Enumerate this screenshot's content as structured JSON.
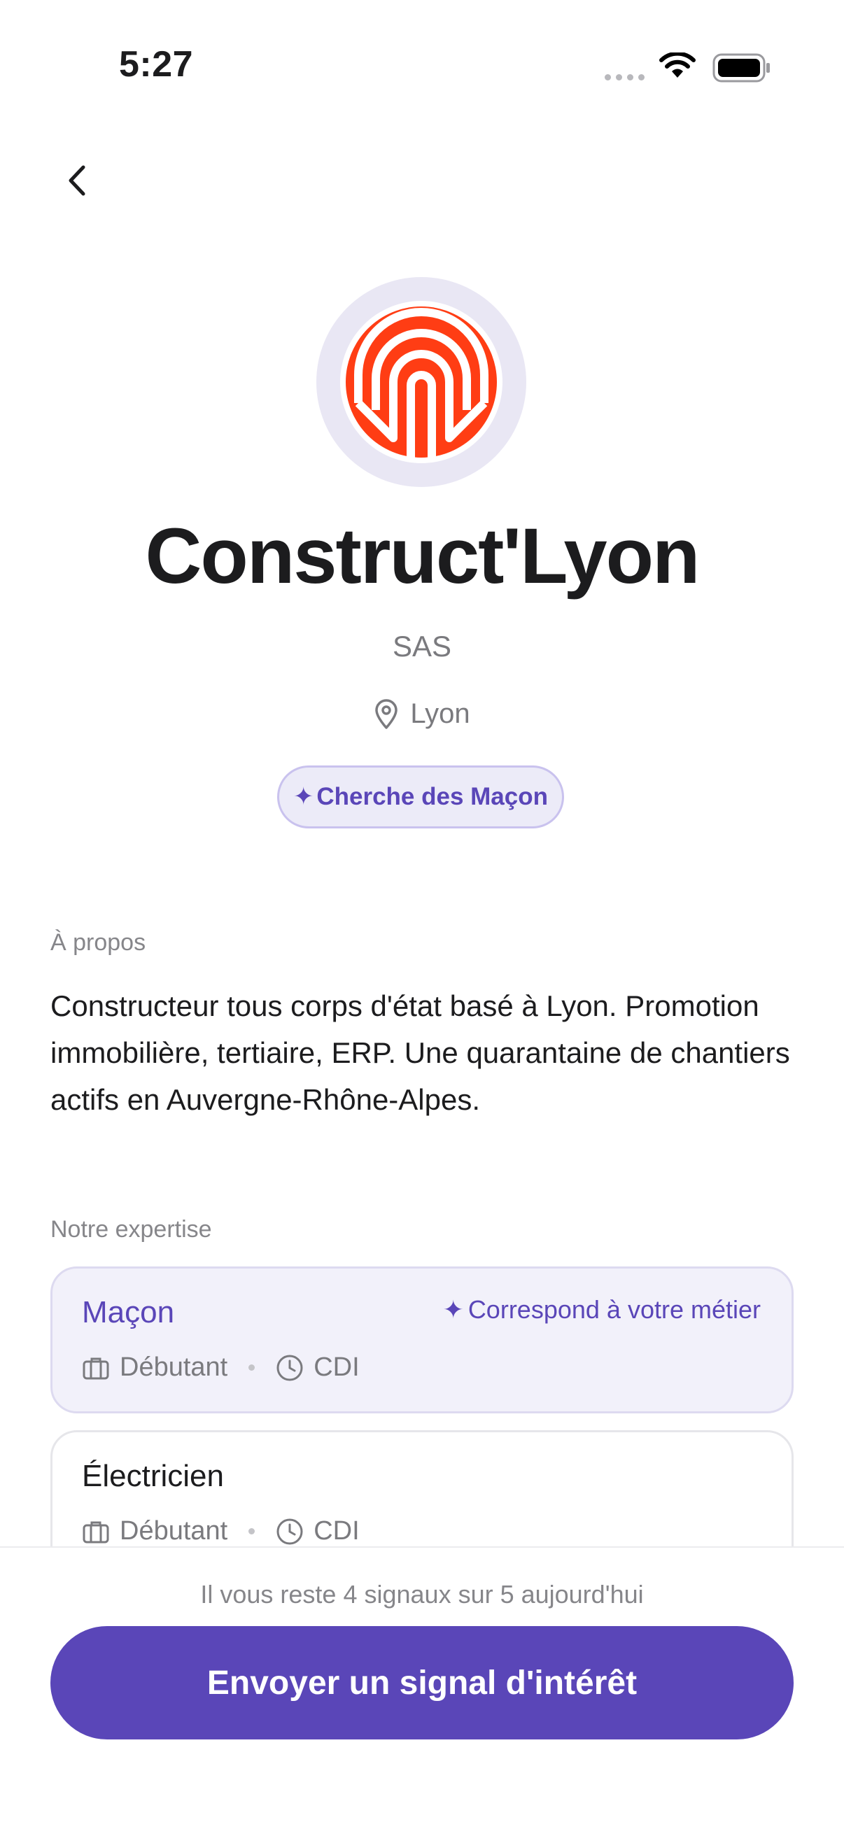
{
  "status_bar": {
    "time": "5:27"
  },
  "company": {
    "name": "Construct'Lyon",
    "legal_form": "SAS",
    "city": "Lyon",
    "looking_for": "Cherche des Maçon",
    "logo_colors": {
      "ring": "#e9e7f4",
      "mark": "#ff3d14"
    }
  },
  "about": {
    "label": "À propos",
    "text": "Constructeur tous corps d'état basé à Lyon. Promotion immobilière, tertiaire, ERP. Une quarantaine de chantiers actifs en Auvergne-Rhône-Alpes."
  },
  "expertise": {
    "label": "Notre expertise",
    "items": [
      {
        "title": "Maçon",
        "level": "Débutant",
        "contract": "CDI",
        "match": "Correspond à votre métier"
      },
      {
        "title": "Électricien",
        "level": "Débutant",
        "contract": "CDI"
      }
    ]
  },
  "footer": {
    "signals_left": "Il vous reste 4 signaux sur 5 aujourd'hui",
    "cta_label": "Envoyer un signal d'intérêt"
  },
  "colors": {
    "accent": "#5a46b8",
    "badge_bg": "#ecebf8",
    "card_matched_bg": "#f2f1fa"
  }
}
